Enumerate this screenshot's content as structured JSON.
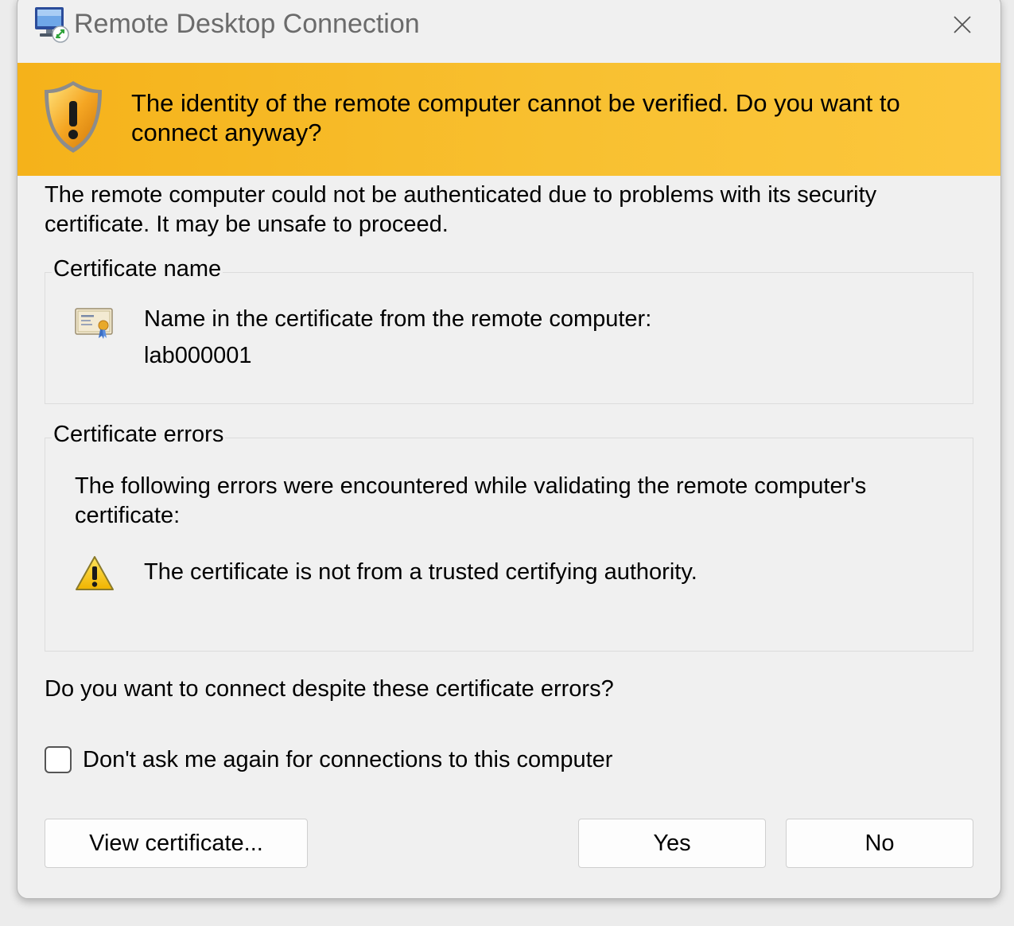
{
  "window": {
    "title": "Remote Desktop Connection",
    "app_icon": "remote-desktop-icon",
    "close_icon": "close-icon"
  },
  "banner": {
    "icon": "warning-shield-icon",
    "text": "The identity of the remote computer cannot be verified. Do you want to connect anyway?",
    "color": "#f7b924"
  },
  "intro": "The remote computer could not be authenticated due to problems with its security certificate. It may be unsafe to proceed.",
  "certificate_name": {
    "legend": "Certificate name",
    "icon": "certificate-icon",
    "label": "Name in the certificate from the remote computer:",
    "value": "lab000001"
  },
  "certificate_errors": {
    "legend": "Certificate errors",
    "intro": "The following errors were encountered while validating the remote computer's certificate:",
    "items": [
      {
        "icon": "warning-icon",
        "text": "The certificate is not from a trusted certifying authority."
      }
    ]
  },
  "question": "Do you want to connect despite these certificate errors?",
  "dont_ask": {
    "label": "Don't ask me again for connections to this computer",
    "checked": false
  },
  "buttons": {
    "view_certificate": "View certificate...",
    "yes": "Yes",
    "no": "No"
  }
}
